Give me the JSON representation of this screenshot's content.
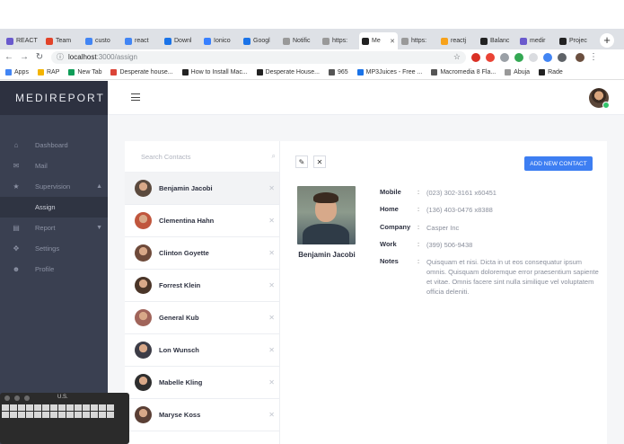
{
  "browser": {
    "tabs": [
      {
        "label": "REACT",
        "color": "#6a5acd",
        "active": false
      },
      {
        "label": "Team",
        "color": "#e24329",
        "active": false
      },
      {
        "label": "custo",
        "color": "#4285f4",
        "active": false
      },
      {
        "label": "react",
        "color": "#4285f4",
        "active": false
      },
      {
        "label": "Downl",
        "color": "#1a73e8",
        "active": false
      },
      {
        "label": "Ionico",
        "color": "#3880ff",
        "active": false
      },
      {
        "label": "Googl",
        "color": "#1a73e8",
        "active": false
      },
      {
        "label": "Notific",
        "color": "#999999",
        "active": false
      },
      {
        "label": "https:",
        "color": "#999999",
        "active": false
      },
      {
        "label": "Me",
        "color": "#222222",
        "active": true
      },
      {
        "label": "https:",
        "color": "#999999",
        "active": false
      },
      {
        "label": "reactj",
        "color": "#f7a21b",
        "active": false
      },
      {
        "label": "Balanc",
        "color": "#222222",
        "active": false
      },
      {
        "label": "medir",
        "color": "#6a5acd",
        "active": false
      },
      {
        "label": "Projec",
        "color": "#222222",
        "active": false
      }
    ],
    "new_tab_glyph": "+",
    "url_host": "localhost",
    "url_path": ":3000/assign",
    "bookmarks": [
      {
        "label": "Apps",
        "color": "#4285f4"
      },
      {
        "label": "RAP",
        "color": "#f4b400"
      },
      {
        "label": "New Tab",
        "color": "#0f9d58"
      },
      {
        "label": "Desperate house...",
        "color": "#db4437"
      },
      {
        "label": "How to Install Mac...",
        "color": "#222222"
      },
      {
        "label": "Desperate House...",
        "color": "#222222"
      },
      {
        "label": "965",
        "color": "#555555"
      },
      {
        "label": "MP3Juices - Free ...",
        "color": "#1a73e8"
      },
      {
        "label": "Macromedia 8 Fla...",
        "color": "#555555"
      },
      {
        "label": "Abuja",
        "color": "#999999"
      },
      {
        "label": "Rade",
        "color": "#222222"
      }
    ]
  },
  "app": {
    "brand": "MEDIREPORT",
    "menu": [
      {
        "label": "Dashboard",
        "icon": "home-icon",
        "glyph": "⌂"
      },
      {
        "label": "Mail",
        "icon": "mail-icon",
        "glyph": "✉"
      },
      {
        "label": "Supervision",
        "icon": "star-icon",
        "glyph": "★",
        "expanded": true
      },
      {
        "label": "Assign",
        "sub": true
      },
      {
        "label": "Report",
        "icon": "report-icon",
        "glyph": "▤"
      },
      {
        "label": "Settings",
        "icon": "settings-icon",
        "glyph": "✥"
      },
      {
        "label": "Profile",
        "icon": "profile-icon",
        "glyph": "☻"
      }
    ]
  },
  "contacts": {
    "search_placeholder": "Search Contacts",
    "items": [
      {
        "name": "Benjamin Jacobi",
        "selected": true,
        "color": "#5b4a3e"
      },
      {
        "name": "Clementina Hahn",
        "selected": false,
        "color": "#c0563d"
      },
      {
        "name": "Clinton Goyette",
        "selected": false,
        "color": "#6e4a3a"
      },
      {
        "name": "Forrest Klein",
        "selected": false,
        "color": "#4a3528"
      },
      {
        "name": "General Kub",
        "selected": false,
        "color": "#a0645a"
      },
      {
        "name": "Lon Wunsch",
        "selected": false,
        "color": "#3c3c46"
      },
      {
        "name": "Mabelle Kling",
        "selected": false,
        "color": "#2e2e2e"
      },
      {
        "name": "Maryse Koss",
        "selected": false,
        "color": "#5a3f35"
      }
    ]
  },
  "detail": {
    "add_button": "ADD NEW CONTACT",
    "edit_glyph": "✎",
    "close_glyph": "✕",
    "name": "Benjamin Jacobi",
    "fields": [
      {
        "label": "Mobile",
        "value": "(023) 302-3161 x60451"
      },
      {
        "label": "Home",
        "value": "(136) 403-0476 x8388"
      },
      {
        "label": "Company",
        "value": "Casper Inc"
      },
      {
        "label": "Work",
        "value": "(399) 506-9438"
      },
      {
        "label": "Notes",
        "value": "Quisquam et nisi. Dicta in ut eos consequatur ipsum omnis. Quisquam doloremque error praesentium sapiente et vitae. Omnis facere sint nulla similique vel voluptatem officia deleniti."
      }
    ]
  },
  "keyboard_viewer": {
    "title": "U.S."
  }
}
